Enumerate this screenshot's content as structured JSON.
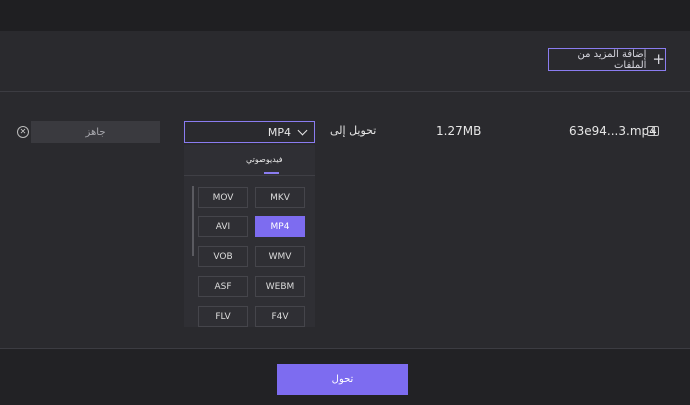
{
  "toolbar": {
    "add_more_files_label": "إضافة المزيد من الملفات"
  },
  "file": {
    "name": "63e94...3.mp4",
    "size": "1.27MB",
    "convert_to_label": "تحويل إلى",
    "selected_format": "MP4",
    "status": "جاهز"
  },
  "dropdown": {
    "tab_label": "فيديوصوتي",
    "formats": [
      "MKV",
      "MOV",
      "MP4",
      "AVI",
      "WMV",
      "VOB",
      "WEBM",
      "ASF",
      "F4V",
      "FLV"
    ],
    "selected": "MP4"
  },
  "footer": {
    "convert_label": "تحول"
  },
  "colors": {
    "accent": "#7d6cf0",
    "background": "#2a2a2e"
  }
}
